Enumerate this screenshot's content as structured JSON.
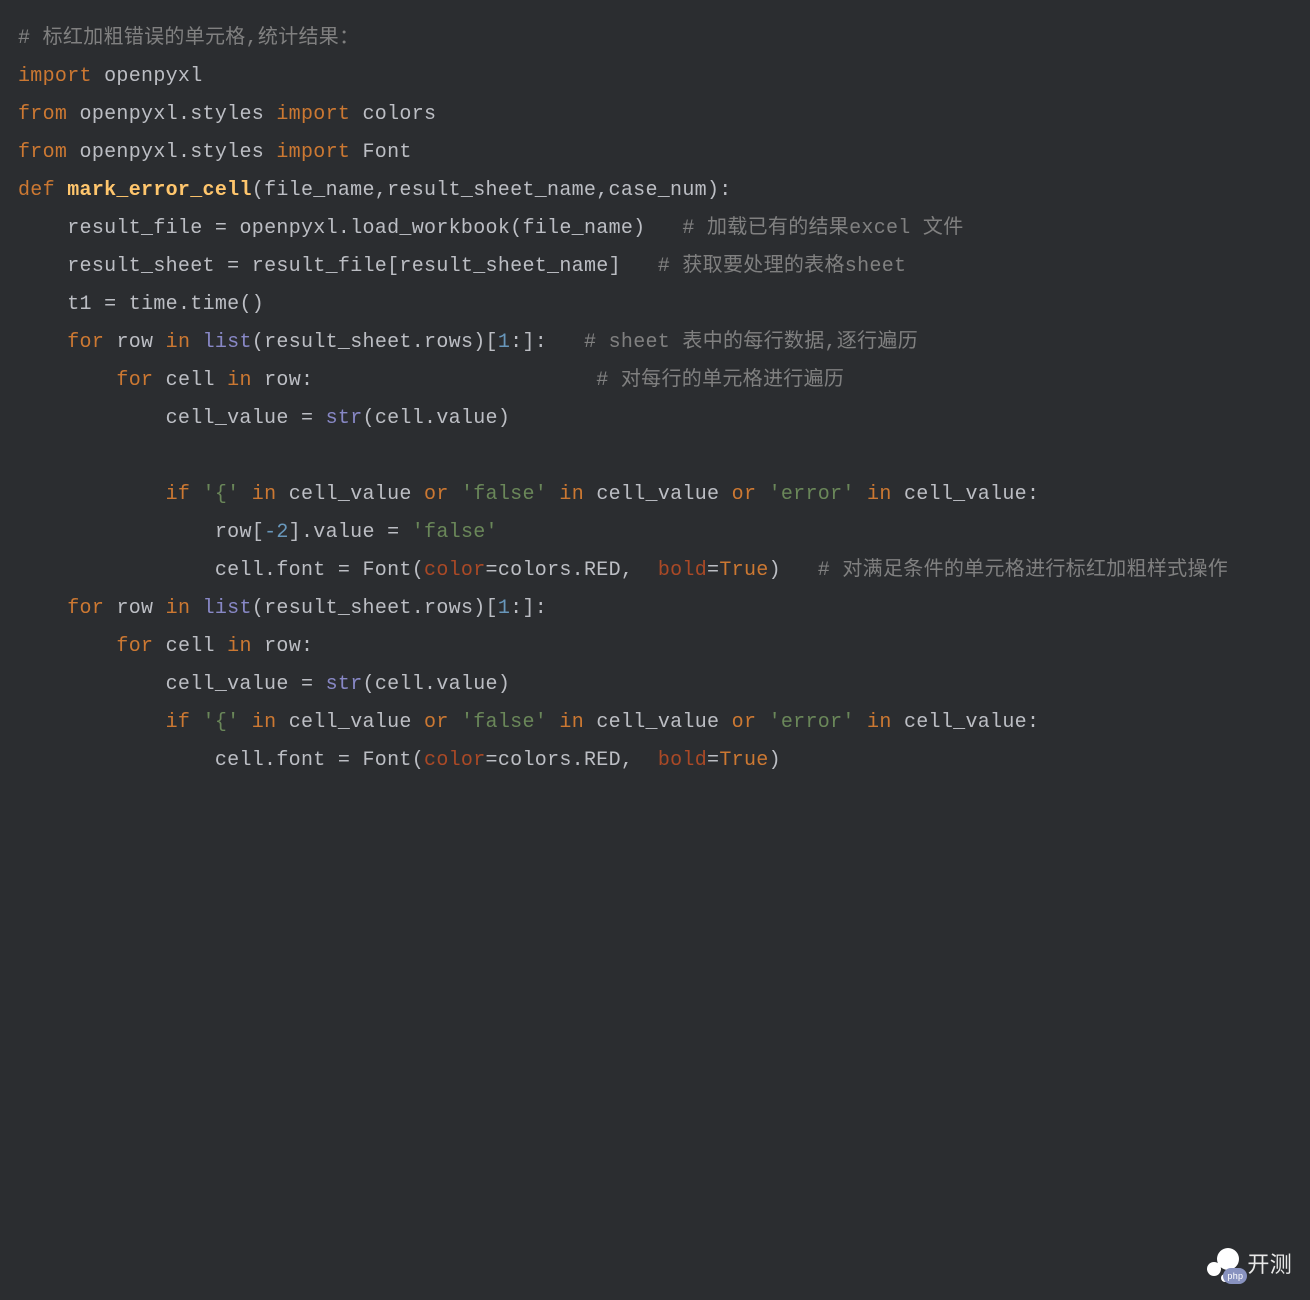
{
  "code": {
    "tokens": [
      {
        "t": "comment",
        "v": "# 标红加粗错误的单元格,统计结果："
      },
      {
        "t": "nl"
      },
      {
        "t": "keyword",
        "v": "import"
      },
      {
        "t": "sp"
      },
      {
        "t": "module",
        "v": "openpyxl"
      },
      {
        "t": "nl"
      },
      {
        "t": "keyword",
        "v": "from"
      },
      {
        "t": "sp"
      },
      {
        "t": "module",
        "v": "openpyxl.styles"
      },
      {
        "t": "sp"
      },
      {
        "t": "keyword",
        "v": "import"
      },
      {
        "t": "sp"
      },
      {
        "t": "module",
        "v": "colors"
      },
      {
        "t": "nl"
      },
      {
        "t": "keyword",
        "v": "from"
      },
      {
        "t": "sp"
      },
      {
        "t": "module",
        "v": "openpyxl.styles"
      },
      {
        "t": "sp"
      },
      {
        "t": "keyword",
        "v": "import"
      },
      {
        "t": "sp"
      },
      {
        "t": "module",
        "v": "Font"
      },
      {
        "t": "nl"
      },
      {
        "t": "keyword",
        "v": "def"
      },
      {
        "t": "sp"
      },
      {
        "t": "funcdef",
        "v": "mark_error_cell"
      },
      {
        "t": "punct",
        "v": "("
      },
      {
        "t": "ident",
        "v": "file_name"
      },
      {
        "t": "punct",
        "v": ","
      },
      {
        "t": "ident",
        "v": "result_sheet_name"
      },
      {
        "t": "punct",
        "v": ","
      },
      {
        "t": "ident",
        "v": "case_num"
      },
      {
        "t": "punct",
        "v": "):"
      },
      {
        "t": "nl"
      },
      {
        "t": "indent",
        "n": 1
      },
      {
        "t": "ident",
        "v": "result_file"
      },
      {
        "t": "sp"
      },
      {
        "t": "punct",
        "v": "="
      },
      {
        "t": "sp"
      },
      {
        "t": "ident",
        "v": "openpyxl.load_workbook"
      },
      {
        "t": "punct",
        "v": "("
      },
      {
        "t": "ident",
        "v": "file_name"
      },
      {
        "t": "punct",
        "v": ")"
      },
      {
        "t": "sp3"
      },
      {
        "t": "comment",
        "v": "# 加载已有的结果excel 文件"
      },
      {
        "t": "nl"
      },
      {
        "t": "indent",
        "n": 1
      },
      {
        "t": "ident",
        "v": "result_sheet"
      },
      {
        "t": "sp"
      },
      {
        "t": "punct",
        "v": "="
      },
      {
        "t": "sp"
      },
      {
        "t": "ident",
        "v": "result_file"
      },
      {
        "t": "punct",
        "v": "["
      },
      {
        "t": "ident",
        "v": "result_sheet_name"
      },
      {
        "t": "punct",
        "v": "]"
      },
      {
        "t": "sp3"
      },
      {
        "t": "comment",
        "v": "# 获取要处理的表格sheet"
      },
      {
        "t": "nl"
      },
      {
        "t": "indent",
        "n": 1
      },
      {
        "t": "ident",
        "v": "t1"
      },
      {
        "t": "sp"
      },
      {
        "t": "punct",
        "v": "="
      },
      {
        "t": "sp"
      },
      {
        "t": "ident",
        "v": "time.time"
      },
      {
        "t": "punct",
        "v": "()"
      },
      {
        "t": "nl"
      },
      {
        "t": "indent",
        "n": 1
      },
      {
        "t": "keyword",
        "v": "for"
      },
      {
        "t": "sp"
      },
      {
        "t": "ident",
        "v": "row"
      },
      {
        "t": "sp"
      },
      {
        "t": "keyword",
        "v": "in"
      },
      {
        "t": "sp"
      },
      {
        "t": "builtin",
        "v": "list"
      },
      {
        "t": "punct",
        "v": "("
      },
      {
        "t": "ident",
        "v": "result_sheet.rows"
      },
      {
        "t": "punct",
        "v": ")["
      },
      {
        "t": "number",
        "v": "1"
      },
      {
        "t": "punct",
        "v": ":]:"
      },
      {
        "t": "sp3"
      },
      {
        "t": "comment",
        "v": "# sheet 表中的每行数据,逐行遍历"
      },
      {
        "t": "nl"
      },
      {
        "t": "indent",
        "n": 2
      },
      {
        "t": "keyword",
        "v": "for"
      },
      {
        "t": "sp"
      },
      {
        "t": "ident",
        "v": "cell"
      },
      {
        "t": "sp"
      },
      {
        "t": "keyword",
        "v": "in"
      },
      {
        "t": "sp"
      },
      {
        "t": "ident",
        "v": "row"
      },
      {
        "t": "punct",
        "v": ":"
      },
      {
        "t": "wide"
      },
      {
        "t": "comment",
        "v": "# 对每行的单元格进行遍历"
      },
      {
        "t": "nl"
      },
      {
        "t": "indent",
        "n": 3
      },
      {
        "t": "ident",
        "v": "cell_value"
      },
      {
        "t": "sp"
      },
      {
        "t": "punct",
        "v": "="
      },
      {
        "t": "sp"
      },
      {
        "t": "builtin",
        "v": "str"
      },
      {
        "t": "punct",
        "v": "("
      },
      {
        "t": "ident",
        "v": "cell.value"
      },
      {
        "t": "punct",
        "v": ")"
      },
      {
        "t": "nl"
      },
      {
        "t": "nl"
      },
      {
        "t": "indent",
        "n": 3
      },
      {
        "t": "keyword",
        "v": "if"
      },
      {
        "t": "sp"
      },
      {
        "t": "string",
        "v": "'{'"
      },
      {
        "t": "sp"
      },
      {
        "t": "keyword",
        "v": "in"
      },
      {
        "t": "sp"
      },
      {
        "t": "ident",
        "v": "cell_value"
      },
      {
        "t": "sp"
      },
      {
        "t": "keyword",
        "v": "or"
      },
      {
        "t": "sp"
      },
      {
        "t": "string",
        "v": "'false'"
      },
      {
        "t": "sp"
      },
      {
        "t": "keyword",
        "v": "in"
      },
      {
        "t": "sp"
      },
      {
        "t": "ident",
        "v": "cell_value"
      },
      {
        "t": "sp"
      },
      {
        "t": "keyword",
        "v": "or"
      },
      {
        "t": "sp"
      },
      {
        "t": "string",
        "v": "'error'"
      },
      {
        "t": "sp"
      },
      {
        "t": "keyword",
        "v": "in"
      },
      {
        "t": "sp"
      },
      {
        "t": "ident",
        "v": "cell_value"
      },
      {
        "t": "punct",
        "v": ":"
      },
      {
        "t": "nl"
      },
      {
        "t": "indent",
        "n": 4
      },
      {
        "t": "ident",
        "v": "row"
      },
      {
        "t": "punct",
        "v": "["
      },
      {
        "t": "number",
        "v": "-2"
      },
      {
        "t": "punct",
        "v": "].value"
      },
      {
        "t": "sp"
      },
      {
        "t": "punct",
        "v": "="
      },
      {
        "t": "sp"
      },
      {
        "t": "string",
        "v": "'false'"
      },
      {
        "t": "nl"
      },
      {
        "t": "indent",
        "n": 4
      },
      {
        "t": "ident",
        "v": "cell.font"
      },
      {
        "t": "sp"
      },
      {
        "t": "punct",
        "v": "="
      },
      {
        "t": "sp"
      },
      {
        "t": "ident",
        "v": "Font"
      },
      {
        "t": "punct",
        "v": "("
      },
      {
        "t": "kwarg",
        "v": "color"
      },
      {
        "t": "punct",
        "v": "="
      },
      {
        "t": "ident",
        "v": "colors.RED"
      },
      {
        "t": "punct",
        "v": ","
      },
      {
        "t": "sp2"
      },
      {
        "t": "kwarg",
        "v": "bold"
      },
      {
        "t": "punct",
        "v": "="
      },
      {
        "t": "bool",
        "v": "True"
      },
      {
        "t": "punct",
        "v": ")"
      },
      {
        "t": "sp3"
      },
      {
        "t": "comment",
        "v": "# 对满足条件的单元格进行标红加粗样式操作"
      },
      {
        "t": "nl"
      },
      {
        "t": "indent",
        "n": 1
      },
      {
        "t": "keyword",
        "v": "for"
      },
      {
        "t": "sp"
      },
      {
        "t": "ident",
        "v": "row"
      },
      {
        "t": "sp"
      },
      {
        "t": "keyword",
        "v": "in"
      },
      {
        "t": "sp"
      },
      {
        "t": "builtin",
        "v": "list"
      },
      {
        "t": "punct",
        "v": "("
      },
      {
        "t": "ident",
        "v": "result_sheet.rows"
      },
      {
        "t": "punct",
        "v": ")["
      },
      {
        "t": "number",
        "v": "1"
      },
      {
        "t": "punct",
        "v": ":]:"
      },
      {
        "t": "nl"
      },
      {
        "t": "indent",
        "n": 2
      },
      {
        "t": "keyword",
        "v": "for"
      },
      {
        "t": "sp"
      },
      {
        "t": "ident",
        "v": "cell"
      },
      {
        "t": "sp"
      },
      {
        "t": "keyword",
        "v": "in"
      },
      {
        "t": "sp"
      },
      {
        "t": "ident",
        "v": "row"
      },
      {
        "t": "punct",
        "v": ":"
      },
      {
        "t": "nl"
      },
      {
        "t": "indent",
        "n": 3
      },
      {
        "t": "ident",
        "v": "cell_value"
      },
      {
        "t": "sp"
      },
      {
        "t": "punct",
        "v": "="
      },
      {
        "t": "sp"
      },
      {
        "t": "builtin",
        "v": "str"
      },
      {
        "t": "punct",
        "v": "("
      },
      {
        "t": "ident",
        "v": "cell.value"
      },
      {
        "t": "punct",
        "v": ")"
      },
      {
        "t": "nl"
      },
      {
        "t": "indent",
        "n": 3
      },
      {
        "t": "keyword",
        "v": "if"
      },
      {
        "t": "sp"
      },
      {
        "t": "string",
        "v": "'{'"
      },
      {
        "t": "sp"
      },
      {
        "t": "keyword",
        "v": "in"
      },
      {
        "t": "sp"
      },
      {
        "t": "ident",
        "v": "cell_value"
      },
      {
        "t": "sp"
      },
      {
        "t": "keyword",
        "v": "or"
      },
      {
        "t": "sp"
      },
      {
        "t": "string",
        "v": "'false'"
      },
      {
        "t": "sp"
      },
      {
        "t": "keyword",
        "v": "in"
      },
      {
        "t": "sp"
      },
      {
        "t": "ident",
        "v": "cell_value"
      },
      {
        "t": "sp"
      },
      {
        "t": "keyword",
        "v": "or"
      },
      {
        "t": "sp"
      },
      {
        "t": "string",
        "v": "'error'"
      },
      {
        "t": "sp"
      },
      {
        "t": "keyword",
        "v": "in"
      },
      {
        "t": "sp"
      },
      {
        "t": "ident",
        "v": "cell_value"
      },
      {
        "t": "punct",
        "v": ":"
      },
      {
        "t": "nl"
      },
      {
        "t": "indent",
        "n": 4
      },
      {
        "t": "ident",
        "v": "cell.font"
      },
      {
        "t": "sp"
      },
      {
        "t": "punct",
        "v": "="
      },
      {
        "t": "sp"
      },
      {
        "t": "ident",
        "v": "Font"
      },
      {
        "t": "punct",
        "v": "("
      },
      {
        "t": "kwarg",
        "v": "color"
      },
      {
        "t": "punct",
        "v": "="
      },
      {
        "t": "ident",
        "v": "colors.RED"
      },
      {
        "t": "punct",
        "v": ","
      },
      {
        "t": "sp2"
      },
      {
        "t": "kwarg",
        "v": "bold"
      },
      {
        "t": "punct",
        "v": "="
      },
      {
        "t": "bool",
        "v": "True"
      },
      {
        "t": "punct",
        "v": ")"
      }
    ]
  },
  "watermark": {
    "text": "开测",
    "badge": "php"
  }
}
